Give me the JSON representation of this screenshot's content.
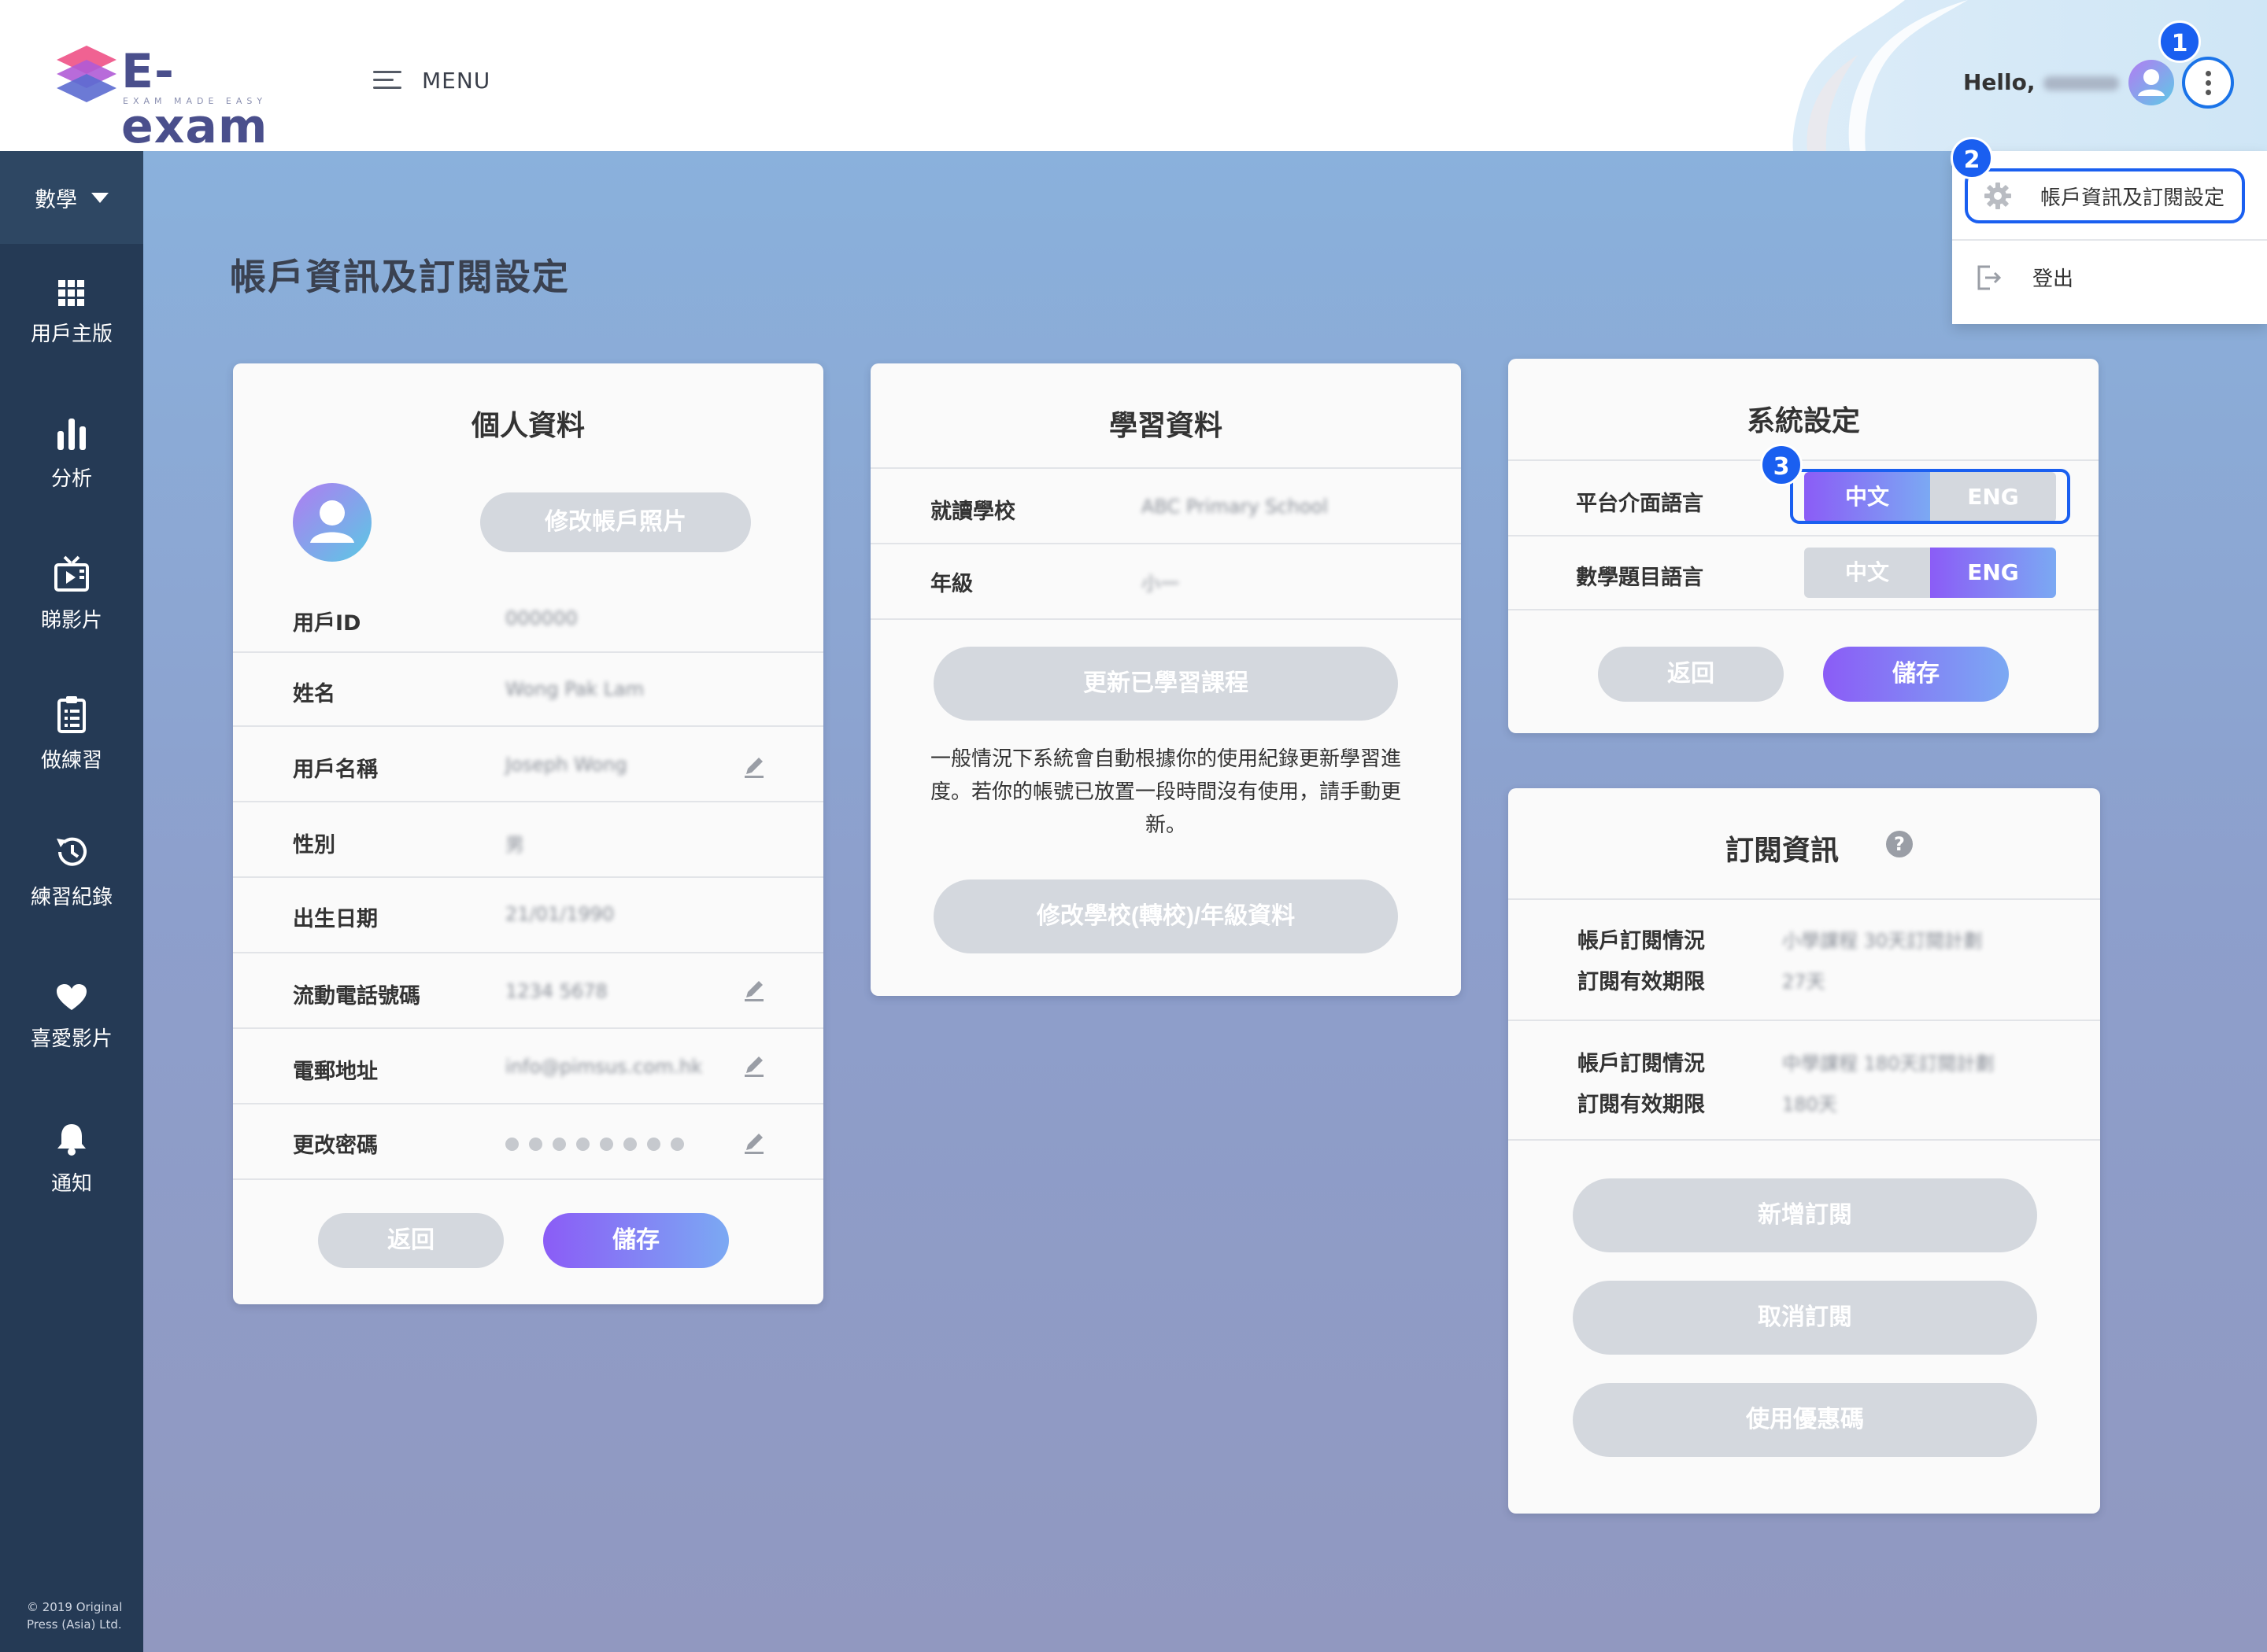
{
  "header": {
    "logo_text": "E-exam",
    "logo_tagline": "EXAM MADE EASY",
    "menu_label": "MENU",
    "greeting": "Hello,",
    "kebab_badge": "1"
  },
  "dropdown": {
    "badge": "2",
    "account_settings": "帳戶資訊及訂閱設定",
    "logout": "登出"
  },
  "sidebar": {
    "subject": "數學",
    "items": [
      {
        "label": "用戶主版",
        "icon": "grid-icon"
      },
      {
        "label": "分析",
        "icon": "bar-chart-icon"
      },
      {
        "label": "睇影片",
        "icon": "tv-icon"
      },
      {
        "label": "做練習",
        "icon": "clipboard-icon"
      },
      {
        "label": "練習紀錄",
        "icon": "history-icon"
      },
      {
        "label": "喜愛影片",
        "icon": "heart-icon"
      },
      {
        "label": "通知",
        "icon": "bell-icon"
      }
    ],
    "copyright": "© 2019 Original Press (Asia) Ltd."
  },
  "page": {
    "title": "帳戶資訊及訂閱設定"
  },
  "personal": {
    "title": "個人資料",
    "change_photo": "修改帳戶照片",
    "rows": [
      {
        "label": "用戶ID",
        "value": "000000"
      },
      {
        "label": "姓名",
        "value": "Wong Pak Lam"
      },
      {
        "label": "用戶名稱",
        "value": "Joseph Wong"
      },
      {
        "label": "性別",
        "value": "男"
      },
      {
        "label": "出生日期",
        "value": "21/01/1990"
      },
      {
        "label": "流動電話號碼",
        "value": "1234 5678"
      },
      {
        "label": "電郵地址",
        "value": "info@pimsus.com.hk"
      },
      {
        "label": "更改密碼",
        "value": ""
      }
    ],
    "back": "返回",
    "save": "儲存"
  },
  "study": {
    "title": "學習資料",
    "rows": [
      {
        "label": "就讀學校",
        "value": "ABC Primary School"
      },
      {
        "label": "年級",
        "value": "小一"
      }
    ],
    "update_btn": "更新已學習課程",
    "note": "一般情況下系統會自動根據你的使用紀錄更新學習進度。若你的帳號已放置一段時間沒有使用，請手動更新。",
    "edit_school_btn": "修改學校(轉校)/年級資料"
  },
  "system": {
    "title": "系統設定",
    "badge": "3",
    "ui_lang_label": "平台介面語言",
    "math_lang_label": "數學題目語言",
    "opt_zh": "中文",
    "opt_en": "ENG",
    "ui_lang_selected": "中文",
    "math_lang_selected": "ENG",
    "back": "返回",
    "save": "儲存"
  },
  "subscription": {
    "title": "訂閱資訊",
    "help": "?",
    "blocks": [
      {
        "status_label": "帳戶訂閱情況",
        "status_value": "小學課程 30天訂閱計劃",
        "expiry_label": "訂閱有效期限",
        "expiry_value": "27天"
      },
      {
        "status_label": "帳戶訂閱情況",
        "status_value": "中學課程 180天訂閱計劃",
        "expiry_label": "訂閱有效期限",
        "expiry_value": "180天"
      }
    ],
    "add_btn": "新增訂閱",
    "cancel_btn": "取消訂閱",
    "coupon_btn": "使用優惠碼"
  },
  "colors": {
    "sidebar": "#253a55",
    "accent_start": "#8b5cf6",
    "accent_end": "#7ba9f3",
    "highlight": "#1a5ff0"
  }
}
